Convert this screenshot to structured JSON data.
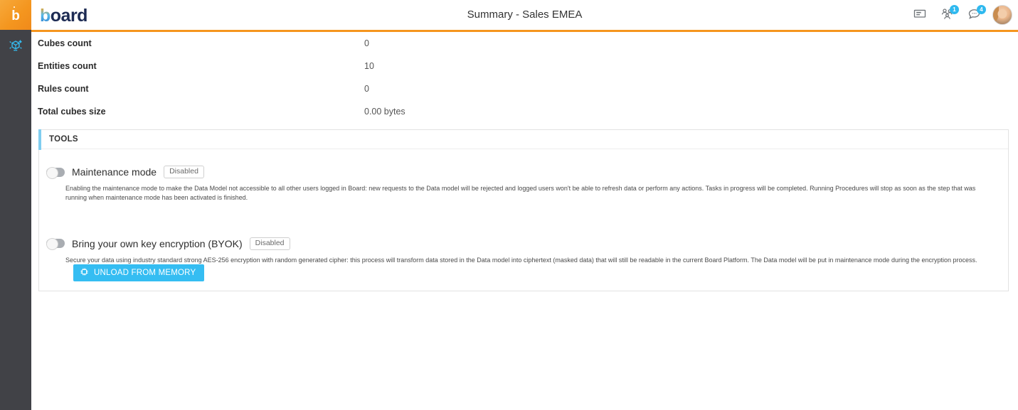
{
  "rail": {
    "logo_glyph": "b",
    "logo_name": "board-rail-logo",
    "item_icon": "data-model-cube-icon"
  },
  "header": {
    "brand_first": "b",
    "brand_rest": "oard",
    "title": "Summary - Sales EMEA",
    "icons": [
      {
        "name": "license-card-icon",
        "badge": null
      },
      {
        "name": "users-group-icon",
        "badge": "1"
      },
      {
        "name": "chat-bubble-icon",
        "badge": "4"
      }
    ],
    "avatar_alt": "user-avatar"
  },
  "summary": {
    "rows": [
      {
        "label": "Cubes count",
        "value": "0"
      },
      {
        "label": "Entities count",
        "value": "10"
      },
      {
        "label": "Rules count",
        "value": "0"
      },
      {
        "label": "Total cubes size",
        "value": "0.00 bytes"
      }
    ]
  },
  "tools": {
    "title": "TOOLS",
    "maintenance": {
      "label": "Maintenance mode",
      "status": "Disabled",
      "description": "Enabling the maintenance mode to make the Data Model not accessible to all other users logged in Board: new requests to the Data model will be rejected and logged users won't be able to refresh data or perform any actions. Tasks in progress will be completed. Running Procedures will stop as soon as the step that was running when maintenance mode has been activated is finished."
    },
    "byok": {
      "label": "Bring your own key encryption (BYOK)",
      "status": "Disabled",
      "description": "Secure your data using industry standard strong AES-256 encryption with random generated cipher: this process will transform data stored in the Data model into ciphertext (masked data) that will still be readable in the current Board Platform. The Data model will be put in maintenance mode during the encryption process."
    },
    "unload_button": {
      "label": "UNLOAD FROM MEMORY",
      "icon": "memory-chip-icon"
    }
  },
  "colors": {
    "accent_orange": "#f5951e",
    "accent_blue": "#35bdf2",
    "panel_accent": "#7fcdf0",
    "rail_bg": "#414247",
    "badge_blue": "#2fb9ef"
  }
}
